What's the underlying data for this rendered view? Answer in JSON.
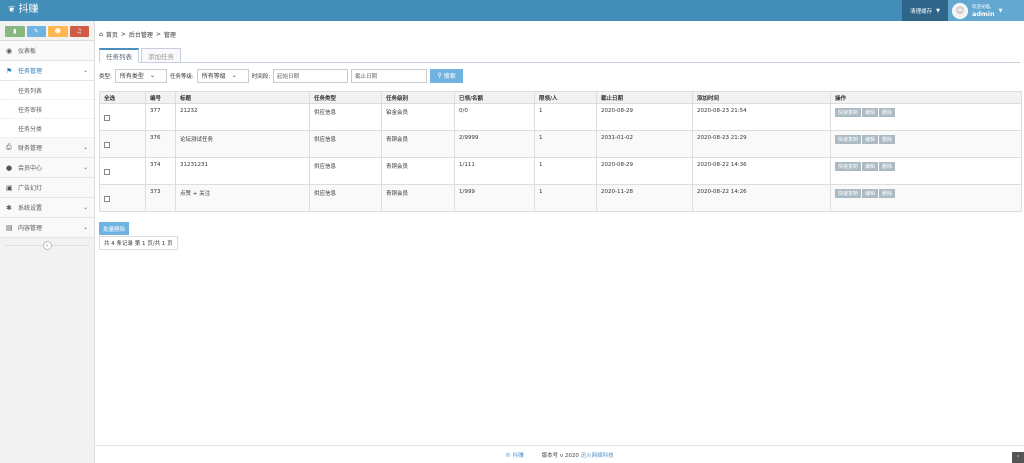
{
  "app": {
    "brand": "抖赚"
  },
  "header": {
    "clear_cache": "清理缓存",
    "welcome": "欢迎光临,",
    "username": "admin"
  },
  "sidebar": {
    "items": [
      {
        "label": "仪表板",
        "icon": "dashboard-icon"
      },
      {
        "label": "任务管理",
        "icon": "flag-icon",
        "active": true
      },
      {
        "label": "财务管理",
        "icon": "print-icon"
      },
      {
        "label": "会员中心",
        "icon": "user-icon"
      },
      {
        "label": "广告幻灯",
        "icon": "picture-icon"
      },
      {
        "label": "系统设置",
        "icon": "gear-icon"
      },
      {
        "label": "内容管理",
        "icon": "book-icon"
      }
    ],
    "submenu": [
      "任务列表",
      "任务审核",
      "任务分类"
    ]
  },
  "breadcrumb": {
    "home": "首页",
    "sep": ">",
    "level2": "后台管理",
    "level3": "管理"
  },
  "tabs": [
    "任务列表",
    "添加任务"
  ],
  "filters": {
    "type_label": "类型:",
    "type_value": "所有类型",
    "level_label": "任务等级:",
    "level_value": "所有等级",
    "time_label": "时间段:",
    "start_placeholder": "起始日期",
    "end_placeholder": "截止日期",
    "search_label": "搜索"
  },
  "table": {
    "headers": [
      "全选",
      "编号",
      "标题",
      "任务类型",
      "任务级别",
      "已领/名额",
      "限领/人",
      "截止日期",
      "添加时间",
      "操作"
    ],
    "rows": [
      {
        "id": "377",
        "title": "21232",
        "type": "供应信息",
        "level": "铂金会员",
        "quota": "0/0",
        "limit": "1",
        "deadline": "2020-08-29",
        "added": "2020-08-23 21:54"
      },
      {
        "id": "376",
        "title": "论坛测试任务",
        "type": "供应信息",
        "level": "青铜会员",
        "quota": "2/9999",
        "limit": "1",
        "deadline": "2031-01-02",
        "added": "2020-08-23 21:29"
      },
      {
        "id": "374",
        "title": "31231231",
        "type": "供应信息",
        "level": "青铜会员",
        "quota": "1/111",
        "limit": "1",
        "deadline": "2020-08-29",
        "added": "2020-08-22 14:36"
      },
      {
        "id": "373",
        "title": "点赞 + 关注",
        "type": "供应信息",
        "level": "青铜会员",
        "quota": "1/999",
        "limit": "1",
        "deadline": "2020-11-28",
        "added": "2020-08-22 14:26"
      }
    ],
    "actions": [
      "快速复制",
      "编辑",
      "删除"
    ]
  },
  "bulk_delete": "批量删除",
  "pager": "共 4 条记录 第 1 页/共 1 页",
  "footer": {
    "brand": "© 抖赚",
    "version": "版本号 v 2020",
    "company": "迅火网络科技"
  },
  "colors": {
    "topbar": "#438eb9",
    "accent": "#6fb3e0",
    "active_menu": "#2b7dbc"
  }
}
